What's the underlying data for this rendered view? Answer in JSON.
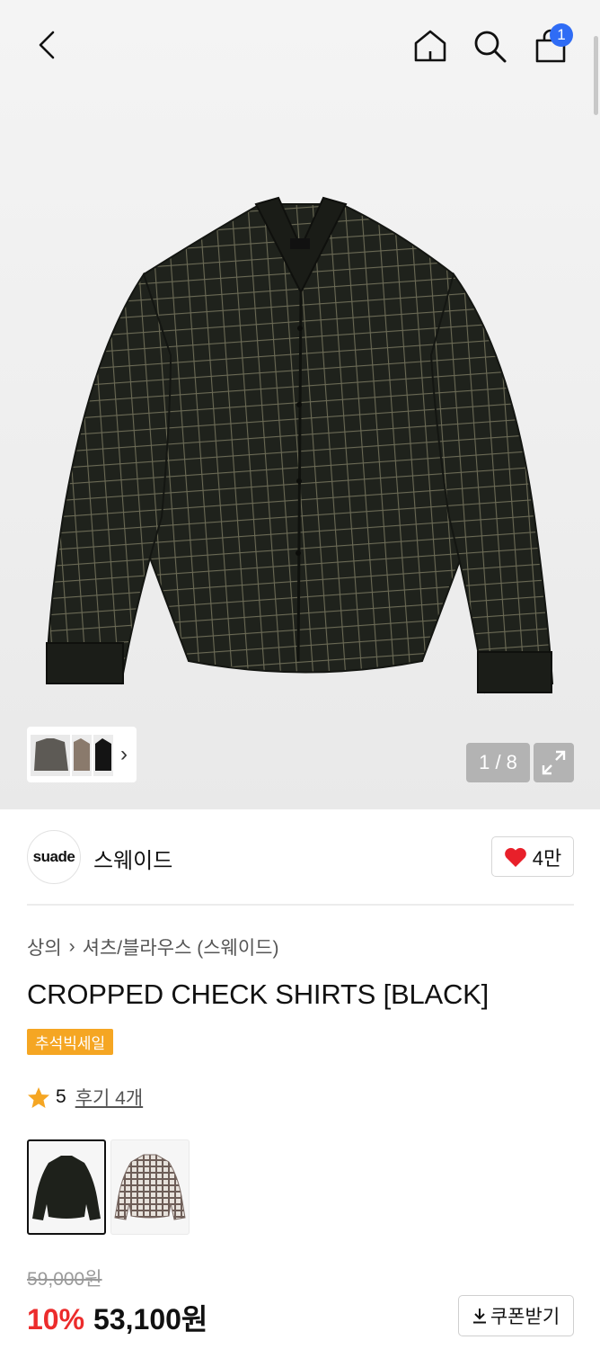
{
  "header": {
    "icons": [
      "back-icon",
      "home-icon",
      "search-icon",
      "cart-icon"
    ],
    "cart_count": "1"
  },
  "gallery": {
    "counter": "1 / 8",
    "thumb_arrow": "›"
  },
  "brand": {
    "logo_text": "suade",
    "name": "스웨이드",
    "likes": "4만"
  },
  "breadcrumb": {
    "category": "상의",
    "separator": "›",
    "subcategory": "셔츠/블라우스 (스웨이드)"
  },
  "product": {
    "title": "CROPPED CHECK SHIRTS [BLACK]",
    "sale_tag": "추석빅세일",
    "rating": "5",
    "reviews": "후기 4개"
  },
  "price": {
    "original": "59,000원",
    "discount": "10%",
    "final": "53,100원",
    "coupon_label": "쿠폰받기"
  },
  "colors": {
    "accent_blue": "#2f6cf5",
    "sale_orange": "#f5a623",
    "discount_red": "#ec2c2c",
    "star": "#f5a623",
    "heart": "#e8202a"
  }
}
